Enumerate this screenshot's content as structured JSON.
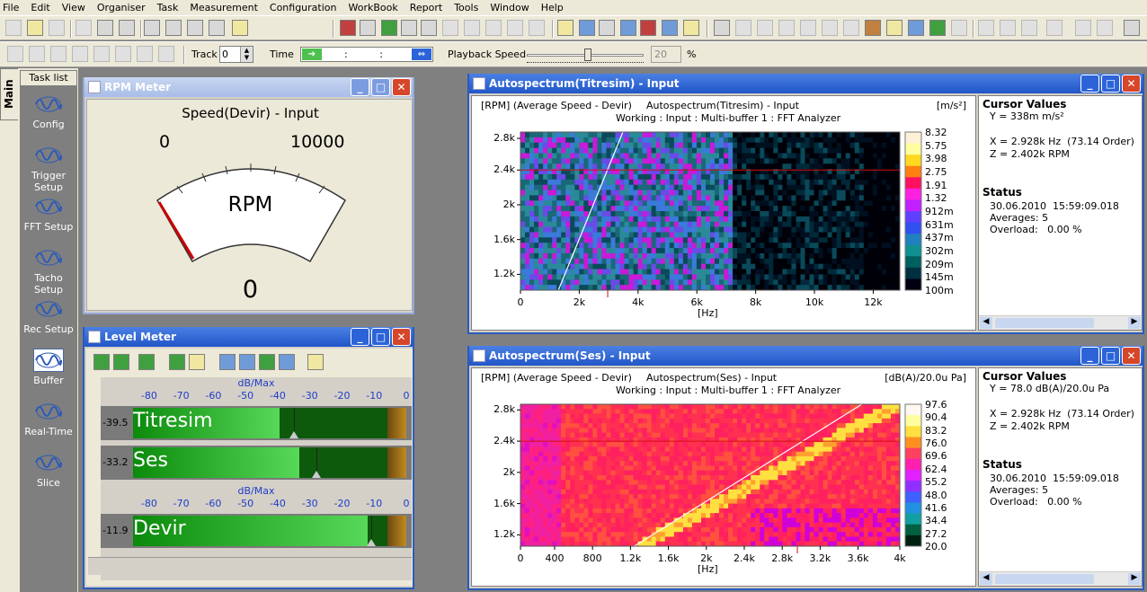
{
  "menu": [
    "File",
    "Edit",
    "View",
    "Organiser",
    "Task",
    "Measurement",
    "Configuration",
    "WorkBook",
    "Report",
    "Tools",
    "Window",
    "Help"
  ],
  "toolbar2": {
    "track_label": "Track",
    "track_value": "0",
    "time_label": "Time",
    "time_value": ":     :     :",
    "playback_label": "Playback Speed",
    "speed_value": "20",
    "speed_unit": "%"
  },
  "leftpanel": {
    "main_tab": "Main",
    "task_list_tab": "Task list",
    "tasks": [
      "Config",
      "Trigger Setup",
      "FFT Setup",
      "Tacho Setup",
      "Rec Setup",
      "Buffer",
      "Real-Time",
      "Slice"
    ],
    "selected": "Buffer"
  },
  "rpm_meter": {
    "title": "RPM Meter",
    "gauge_title": "Speed(Devir) - Input",
    "min_label": "0",
    "max_label": "10000",
    "unit": "RPM",
    "value": "0",
    "needle_fraction": 0
  },
  "level_meter": {
    "title": "Level Meter",
    "axis_title": "dB/Max",
    "ticks": [
      "-80",
      "-70",
      "-60",
      "-50",
      "-40",
      "-30",
      "-20",
      "-10",
      "0"
    ],
    "channels": [
      {
        "name": "Titresim",
        "value": "-39.5",
        "level_db": -39.5,
        "peak_db": -35
      },
      {
        "name": "Ses",
        "value": "-33.2",
        "level_db": -33.2,
        "peak_db": -28
      },
      {
        "name": "Devir",
        "value": "-11.9",
        "level_db": -11.9,
        "peak_db": -11
      }
    ]
  },
  "spectrum_top": {
    "title": "Autospectrum(Titresim) - Input",
    "yaxis_label": "[RPM] (Average Speed - Devir)",
    "chart_title": "Autospectrum(Titresim) - Input",
    "unit": "[m/s²]",
    "subtitle": "Working : Input : Multi-buffer 1 : FFT Analyzer",
    "xunit": "[Hz]",
    "xticks": [
      "0",
      "2k",
      "4k",
      "6k",
      "8k",
      "10k",
      "12k"
    ],
    "yticks": [
      "2.8k",
      "2.4k",
      "2k",
      "1.6k",
      "1.2k"
    ],
    "scale": [
      "8.32",
      "5.75",
      "3.98",
      "2.75",
      "1.91",
      "1.32",
      "912m",
      "631m",
      "437m",
      "302m",
      "209m",
      "145m",
      "100m"
    ],
    "cursor": {
      "title": "Cursor Values",
      "y": "Y = 338m m/s²",
      "x": "X = 2.928k Hz  (73.14 Order)",
      "z": "Z = 2.402k RPM"
    },
    "status": {
      "title": "Status",
      "date": "30.06.2010  15:59:09.018",
      "averages": "Averages: 5",
      "overload": "Overload:   0.00 %"
    }
  },
  "spectrum_bottom": {
    "title": "Autospectrum(Ses) - Input",
    "yaxis_label": "[RPM] (Average Speed - Devir)",
    "chart_title": "Autospectrum(Ses) - Input",
    "unit": "[dB(A)/20.0u Pa]",
    "subtitle": "Working : Input : Multi-buffer 1 : FFT Analyzer",
    "xunit": "[Hz]",
    "xticks": [
      "0",
      "400",
      "800",
      "1.2k",
      "1.6k",
      "2k",
      "2.4k",
      "2.8k",
      "3.2k",
      "3.6k",
      "4k"
    ],
    "yticks": [
      "2.8k",
      "2.4k",
      "2k",
      "1.6k",
      "1.2k"
    ],
    "scale": [
      "97.6",
      "90.4",
      "83.2",
      "76.0",
      "69.6",
      "62.4",
      "55.2",
      "48.0",
      "41.6",
      "34.4",
      "27.2",
      "20.0"
    ],
    "cursor": {
      "title": "Cursor Values",
      "y": "Y = 78.0 dB(A)/20.0u Pa",
      "x": "X = 2.928k Hz  (73.14 Order)",
      "z": "Z = 2.402k RPM"
    },
    "status": {
      "title": "Status",
      "date": "30.06.2010  15:59:09.018",
      "averages": "Averages: 5",
      "overload": "Overload:   0.00 %"
    }
  },
  "colors": {
    "titlebar": "#2156c8",
    "level_green": "#4cc44c",
    "close": "#d6462a"
  }
}
